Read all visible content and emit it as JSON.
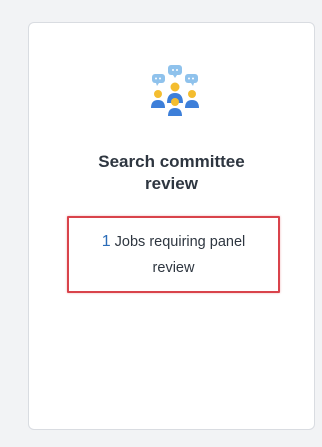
{
  "card": {
    "icon": "people-discussion-icon",
    "title_line1": "Search committee",
    "title_line2": "review",
    "jobs_count": "1",
    "jobs_text_line1": "Jobs requiring panel",
    "jobs_text_line2": "review"
  },
  "colors": {
    "background": "#f2f3f5",
    "card": "#ffffff",
    "title_text": "#2e3640",
    "count_link": "#2b6cb8",
    "highlight_border": "#d9434b",
    "icon_blue": "#3d7fd9",
    "icon_yellow": "#f4bd2f",
    "icon_light_blue": "#8fc2ec"
  }
}
